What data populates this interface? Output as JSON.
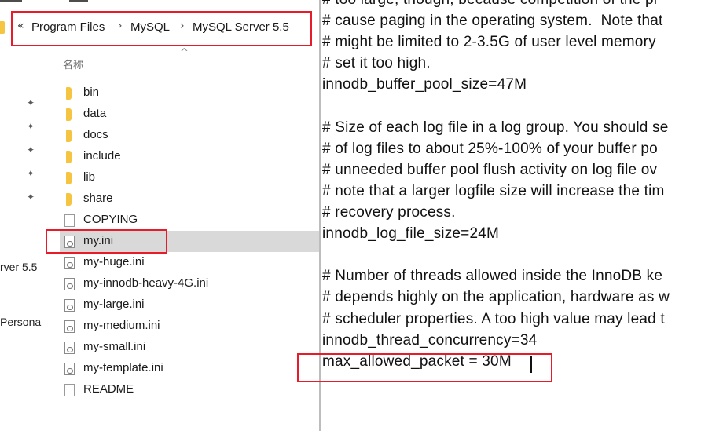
{
  "address_bar": {
    "breadcrumbs": [
      "Program Files",
      "MySQL",
      "MySQL Server 5.5"
    ],
    "overflow_glyph": "«",
    "separator": "›"
  },
  "file_list": {
    "column_header": "名称",
    "items": [
      {
        "name": "bin",
        "type": "folder"
      },
      {
        "name": "data",
        "type": "folder"
      },
      {
        "name": "docs",
        "type": "folder"
      },
      {
        "name": "include",
        "type": "folder"
      },
      {
        "name": "lib",
        "type": "folder"
      },
      {
        "name": "share",
        "type": "folder"
      },
      {
        "name": "COPYING",
        "type": "file"
      },
      {
        "name": "my.ini",
        "type": "ini",
        "selected": true
      },
      {
        "name": "my-huge.ini",
        "type": "ini"
      },
      {
        "name": "my-innodb-heavy-4G.ini",
        "type": "ini"
      },
      {
        "name": "my-large.ini",
        "type": "ini"
      },
      {
        "name": "my-medium.ini",
        "type": "ini"
      },
      {
        "name": "my-small.ini",
        "type": "ini"
      },
      {
        "name": "my-template.ini",
        "type": "ini"
      },
      {
        "name": "README",
        "type": "file"
      }
    ]
  },
  "nav_pane": {
    "partial_labels": [
      "rver 5.5",
      "Persona"
    ],
    "pin_icon": "pin-icon"
  },
  "editor": {
    "lines": [
      "# too large, though, because competition of the pr",
      "# cause paging in the operating system.  Note that",
      "# might be limited to 2-3.5G of user level memory",
      "# set it too high.",
      "innodb_buffer_pool_size=47M",
      "",
      "# Size of each log file in a log group. You should se",
      "# of log files to about 25%-100% of your buffer po",
      "# unneeded buffer pool flush activity on log file ov",
      "# note that a larger logfile size will increase the tim",
      "# recovery process.",
      "innodb_log_file_size=24M",
      "",
      "# Number of threads allowed inside the InnoDB ke",
      "# depends highly on the application, hardware as w",
      "# scheduler properties. A too high value may lead t",
      "innodb_thread_concurrency=34",
      "max_allowed_packet = 30M"
    ]
  },
  "colors": {
    "highlight_red": "#e81b2b",
    "folder_yellow": "#f5c542",
    "selection_gray": "#d9d9d9"
  }
}
